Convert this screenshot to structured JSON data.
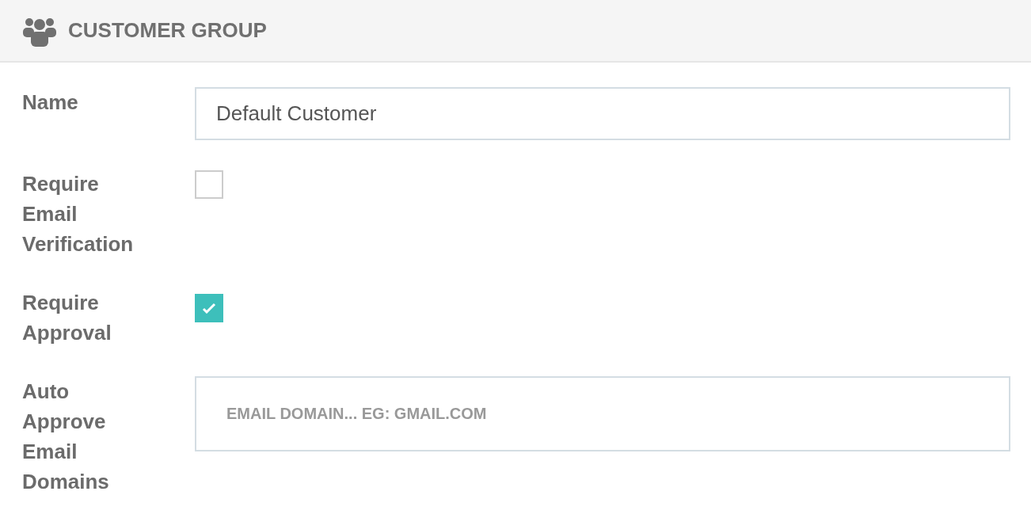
{
  "header": {
    "title": "CUSTOMER GROUP"
  },
  "fields": [
    {
      "kind": "text",
      "label": "Name",
      "value": "Default Customer"
    },
    {
      "kind": "checkbox",
      "label": "Require Email Verification",
      "checked": false
    },
    {
      "kind": "checkbox",
      "label": "Require Approval",
      "checked": true
    },
    {
      "kind": "tall-text",
      "label": "Auto Approve Email Domains",
      "placeholder": "EMAIL DOMAIN... EG: GMAIL.COM"
    }
  ]
}
